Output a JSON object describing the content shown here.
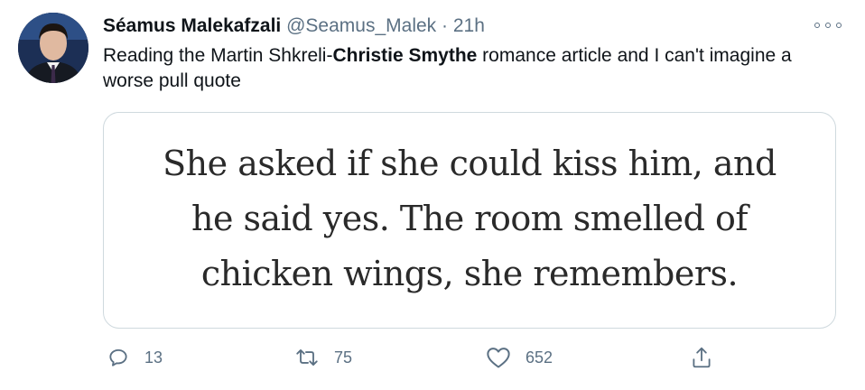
{
  "author": {
    "display_name": "Séamus Malekafzali",
    "handle": "@Seamus_Malek",
    "separator": "·",
    "time": "21h"
  },
  "tweet": {
    "text_before": "Reading the Martin Shkreli-",
    "text_bold": "Christie Smythe",
    "text_after": " romance article and I can't imagine a worse pull quote"
  },
  "quote_image": {
    "text": "She asked if she could kiss him, and he said yes. The room smelled of chicken wings, she remembers."
  },
  "actions": {
    "reply_count": "13",
    "retweet_count": "75",
    "like_count": "652"
  },
  "icons": {
    "more": "more-horizontal-icon",
    "reply": "reply-icon",
    "retweet": "retweet-icon",
    "like": "heart-icon",
    "share": "share-icon"
  },
  "colors": {
    "text": "#0f1419",
    "secondary": "#5b7083",
    "border": "#cfd9de"
  }
}
